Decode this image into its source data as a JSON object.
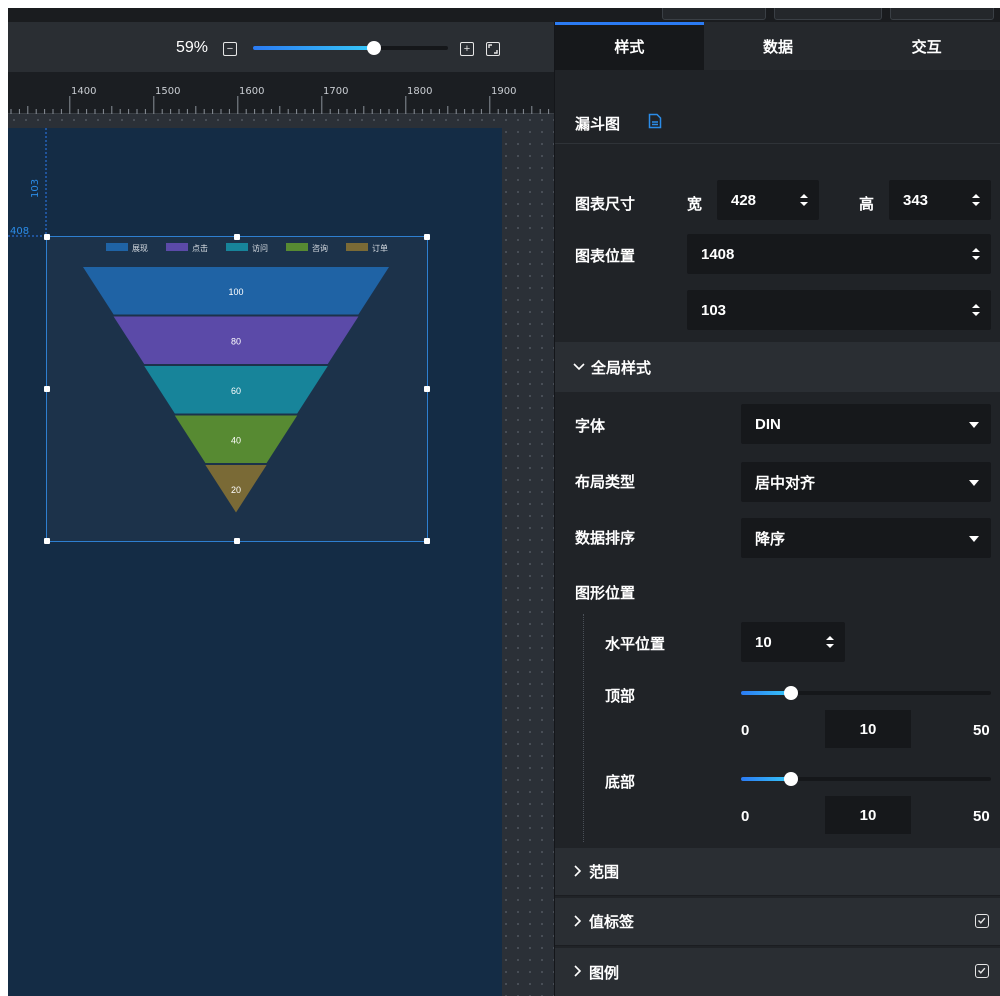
{
  "zoom": {
    "percent_label": "59%",
    "value": 0.59
  },
  "ruler": {
    "labels": [
      "1400",
      "1500",
      "1600",
      "1700",
      "1800",
      "1900"
    ]
  },
  "guides": {
    "x_label": "408",
    "y_label": "103"
  },
  "chart_data": {
    "type": "funnel",
    "legend": [
      "展现",
      "点击",
      "访问",
      "咨询",
      "订单"
    ],
    "values": [
      100,
      80,
      60,
      40,
      20
    ],
    "colors": [
      "#1f63a5",
      "#5b4aa8",
      "#17849a",
      "#578a32",
      "#7a6a36"
    ]
  },
  "tabs": [
    {
      "label": "样式",
      "active": true
    },
    {
      "label": "数据",
      "active": false
    },
    {
      "label": "交互",
      "active": false
    }
  ],
  "component": {
    "title": "漏斗图"
  },
  "size": {
    "label": "图表尺寸",
    "width_label": "宽",
    "width": "428",
    "height_label": "高",
    "height": "343"
  },
  "position": {
    "label": "图表位置",
    "x": "1408",
    "y": "103"
  },
  "global_style": {
    "title": "全局样式",
    "font": {
      "label": "字体",
      "value": "DIN"
    },
    "layout": {
      "label": "布局类型",
      "value": "居中对齐"
    },
    "sort": {
      "label": "数据排序",
      "value": "降序"
    },
    "shape_position": {
      "label": "图形位置",
      "horizontal": {
        "label": "水平位置",
        "value": "10"
      },
      "top": {
        "label": "顶部",
        "value": "10",
        "min": "0",
        "max": "50",
        "fraction": 0.2
      },
      "bottom": {
        "label": "底部",
        "value": "10",
        "min": "0",
        "max": "50",
        "fraction": 0.2
      }
    }
  },
  "sections": {
    "range": {
      "label": "范围"
    },
    "value_label": {
      "label": "值标签",
      "checked": true
    },
    "legend": {
      "label": "图例",
      "checked": true
    }
  }
}
